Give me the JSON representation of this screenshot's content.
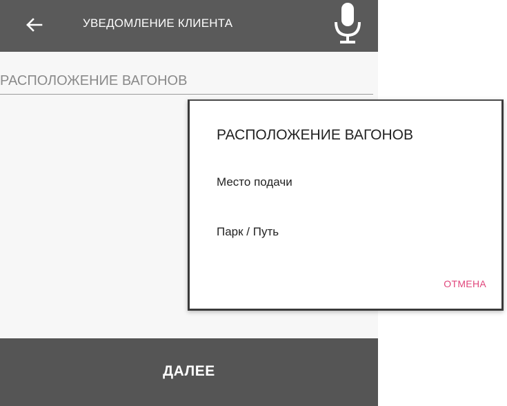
{
  "header": {
    "back_icon": "arrow-left-icon",
    "title": "УВЕДОМЛЕНИЕ КЛИЕНТА",
    "mic_icon": "microphone-icon"
  },
  "form": {
    "field_placeholder": "РАСПОЛОЖЕНИЕ ВАГОНОВ"
  },
  "dialog": {
    "title": "РАСПОЛОЖЕНИЕ ВАГОНОВ",
    "options": [
      "Место подачи",
      "Парк / Путь"
    ],
    "cancel_label": "ОТМЕНА"
  },
  "footer": {
    "next_label": "ДАЛЕЕ"
  },
  "colors": {
    "toolbar": "#5a5a5a",
    "footer": "#555555",
    "accent": "#e0457b",
    "background": "#f7f7f7"
  }
}
